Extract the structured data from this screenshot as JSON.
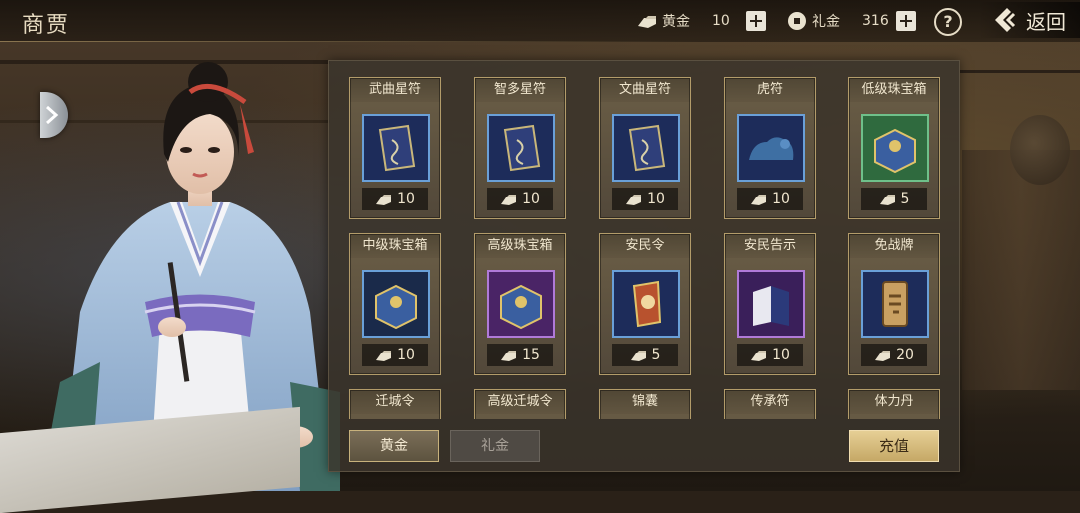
{
  "header": {
    "title": "商贾",
    "gold": {
      "label": "黄金",
      "value": "10"
    },
    "gift": {
      "label": "礼金",
      "value": "316"
    },
    "help_label": "?",
    "back_label": "返回"
  },
  "shop": {
    "items": [
      {
        "name": "武曲星符",
        "price": "10",
        "icon": "talisman-card-icon",
        "frame": "blue"
      },
      {
        "name": "智多星符",
        "price": "10",
        "icon": "talisman-card-icon",
        "frame": "blue"
      },
      {
        "name": "文曲星符",
        "price": "10",
        "icon": "talisman-card-icon",
        "frame": "blue"
      },
      {
        "name": "虎符",
        "price": "10",
        "icon": "tiger-tally-icon",
        "frame": "blue"
      },
      {
        "name": "低级珠宝箱",
        "price": "5",
        "icon": "jewel-box-icon",
        "frame": "green"
      },
      {
        "name": "中级珠宝箱",
        "price": "10",
        "icon": "jewel-box-icon",
        "frame": "blue"
      },
      {
        "name": "高级珠宝箱",
        "price": "15",
        "icon": "jewel-box-icon",
        "frame": "purple"
      },
      {
        "name": "安民令",
        "price": "5",
        "icon": "decree-token-icon",
        "frame": "blue"
      },
      {
        "name": "安民告示",
        "price": "10",
        "icon": "notice-book-icon",
        "frame": "purple"
      },
      {
        "name": "免战牌",
        "price": "20",
        "icon": "truce-plate-icon",
        "frame": "blue"
      },
      {
        "name": "迁城令",
        "price": "",
        "icon": "",
        "frame": "blue"
      },
      {
        "name": "高级迁城令",
        "price": "",
        "icon": "",
        "frame": "blue"
      },
      {
        "name": "锦囊",
        "price": "",
        "icon": "",
        "frame": "blue"
      },
      {
        "name": "传承符",
        "price": "",
        "icon": "",
        "frame": "blue"
      },
      {
        "name": "体力丹",
        "price": "",
        "icon": "",
        "frame": "blue"
      }
    ],
    "tabs": {
      "gold": "黄金",
      "gift": "礼金"
    },
    "recharge_label": "充值"
  },
  "colors": {
    "gold_accent": "#c5a866",
    "frame_blue": "#6aa0d8",
    "frame_green": "#6fc08a",
    "frame_purple": "#b07ad8"
  }
}
